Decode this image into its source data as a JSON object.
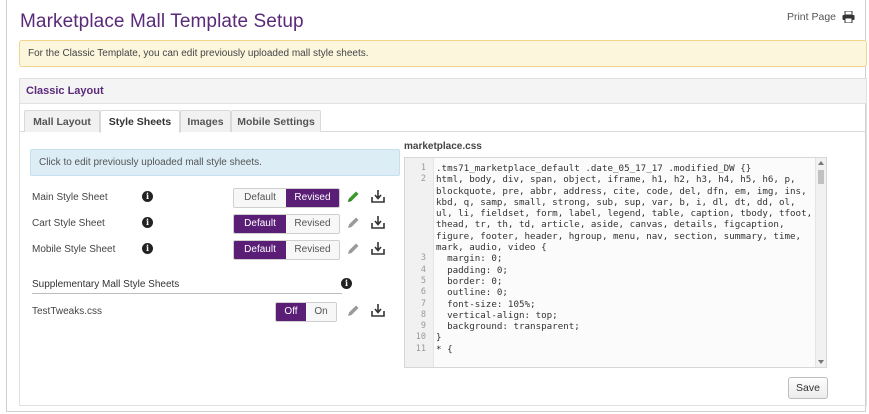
{
  "page": {
    "title": "Marketplace Mall Template Setup",
    "print_label": "Print Page"
  },
  "notice": "For the Classic Template, you can edit previously uploaded mall style sheets.",
  "section": {
    "title": "Classic Layout"
  },
  "tabs": [
    {
      "label": "Mall Layout",
      "active": false
    },
    {
      "label": "Style Sheets",
      "active": true
    },
    {
      "label": "Images",
      "active": false
    },
    {
      "label": "Mobile Settings",
      "active": false
    }
  ],
  "style_sheets": {
    "info": "Click to edit previously uploaded mall style sheets.",
    "rows": [
      {
        "label": "Main Style Sheet",
        "option_a": "Default",
        "option_b": "Revised",
        "selected": "Revised",
        "edit_active": true
      },
      {
        "label": "Cart Style Sheet",
        "option_a": "Default",
        "option_b": "Revised",
        "selected": "Default",
        "edit_active": false
      },
      {
        "label": "Mobile Style Sheet",
        "option_a": "Default",
        "option_b": "Revised",
        "selected": "Default",
        "edit_active": false
      }
    ],
    "supplementary_title": "Supplementary Mall Style Sheets",
    "supplementary": [
      {
        "label": "TestTweaks.css",
        "option_a": "Off",
        "option_b": "On",
        "selected": "Off",
        "edit_active": false
      }
    ]
  },
  "editor": {
    "filename": "marketplace.css",
    "lines": [
      {
        "n": "1",
        "text": ".tms71_marketplace_default .date_05_17_17 .modified_DW {}"
      },
      {
        "n": "2",
        "text": "html, body, div, span, object, iframe, h1, h2, h3, h4, h5, h6, p,"
      },
      {
        "n": "",
        "text": "blockquote, pre, abbr, address, cite, code, del, dfn, em, img, ins,"
      },
      {
        "n": "",
        "text": "kbd, q, samp, small, strong, sub, sup, var, b, i, dl, dt, dd, ol,"
      },
      {
        "n": "",
        "text": "ul, li, fieldset, form, label, legend, table, caption, tbody, tfoot,"
      },
      {
        "n": "",
        "text": "thead, tr, th, td, article, aside, canvas, details, figcaption,"
      },
      {
        "n": "",
        "text": "figure, footer, header, hgroup, menu, nav, section, summary, time,"
      },
      {
        "n": "",
        "text": "mark, audio, video {"
      },
      {
        "n": "3",
        "text": "  margin: 0;"
      },
      {
        "n": "4",
        "text": "  padding: 0;"
      },
      {
        "n": "5",
        "text": "  border: 0;"
      },
      {
        "n": "6",
        "text": "  outline: 0;"
      },
      {
        "n": "7",
        "text": "  font-size: 105%;"
      },
      {
        "n": "8",
        "text": "  vertical-align: top;"
      },
      {
        "n": "9",
        "text": "  background: transparent;"
      },
      {
        "n": "10",
        "text": "}"
      },
      {
        "n": "11",
        "text": "* {"
      }
    ]
  },
  "save_label": "Save",
  "colors": {
    "accent_purple": "#5a1e77",
    "edit_active_green": "#3a9a2a",
    "notice_bg": "#fcf6dd",
    "info_bg": "#dcedf6"
  }
}
